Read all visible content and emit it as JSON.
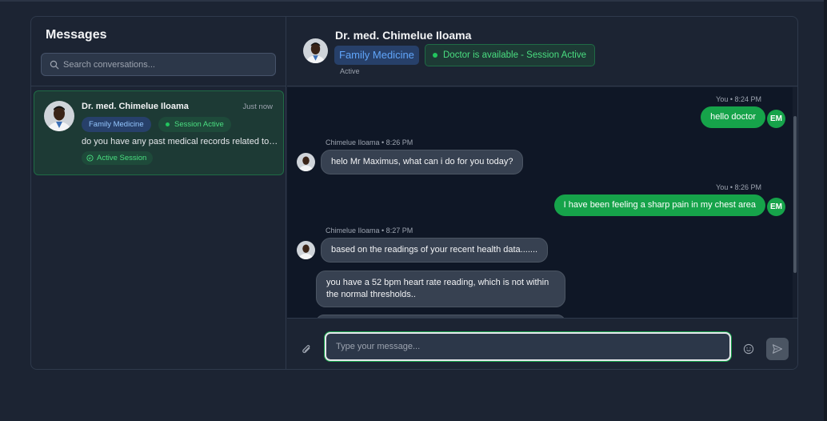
{
  "sidebar": {
    "title": "Messages",
    "search_placeholder": "Search conversations...",
    "conversation": {
      "name": "Dr. med. Chimelue Iloama",
      "time": "Just now",
      "specialty": "Family Medicine",
      "session_status": "Session Active",
      "preview": "do you have any past medical records related to this?",
      "active_badge": "Active Session"
    }
  },
  "header": {
    "name": "Dr. med. Chimelue Iloama",
    "specialty": "Family Medicine",
    "availability": "Doctor is available - Session Active",
    "status": "Active"
  },
  "messages": [
    {
      "sender": "You",
      "meta": "You • 8:24 PM",
      "text": "hello doctor",
      "initials": "EM"
    },
    {
      "sender": "doctor",
      "meta": "Chimelue Iloama • 8:26 PM",
      "text": "helo Mr Maximus, what can i do for you today?"
    },
    {
      "sender": "You",
      "meta": "You • 8:26 PM",
      "text": "I have been feeling a sharp pain in my chest area",
      "initials": "EM"
    },
    {
      "sender": "doctor",
      "meta": "Chimelue Iloama • 8:27 PM",
      "text": "based on the readings of your recent health data......."
    },
    {
      "sender": "doctor",
      "text": "you have a 52 bpm heart rate reading, which is not within the normal thresholds.."
    }
  ],
  "composer": {
    "placeholder": "Type your message..."
  },
  "colors": {
    "accent_green": "#16a34a",
    "badge_blue": "#60a5fa",
    "background": "#1c2433",
    "messages_background": "#0f1726"
  },
  "icons": [
    "search-icon",
    "paperclip-icon",
    "smile-icon",
    "send-icon",
    "message-circle-icon"
  ]
}
